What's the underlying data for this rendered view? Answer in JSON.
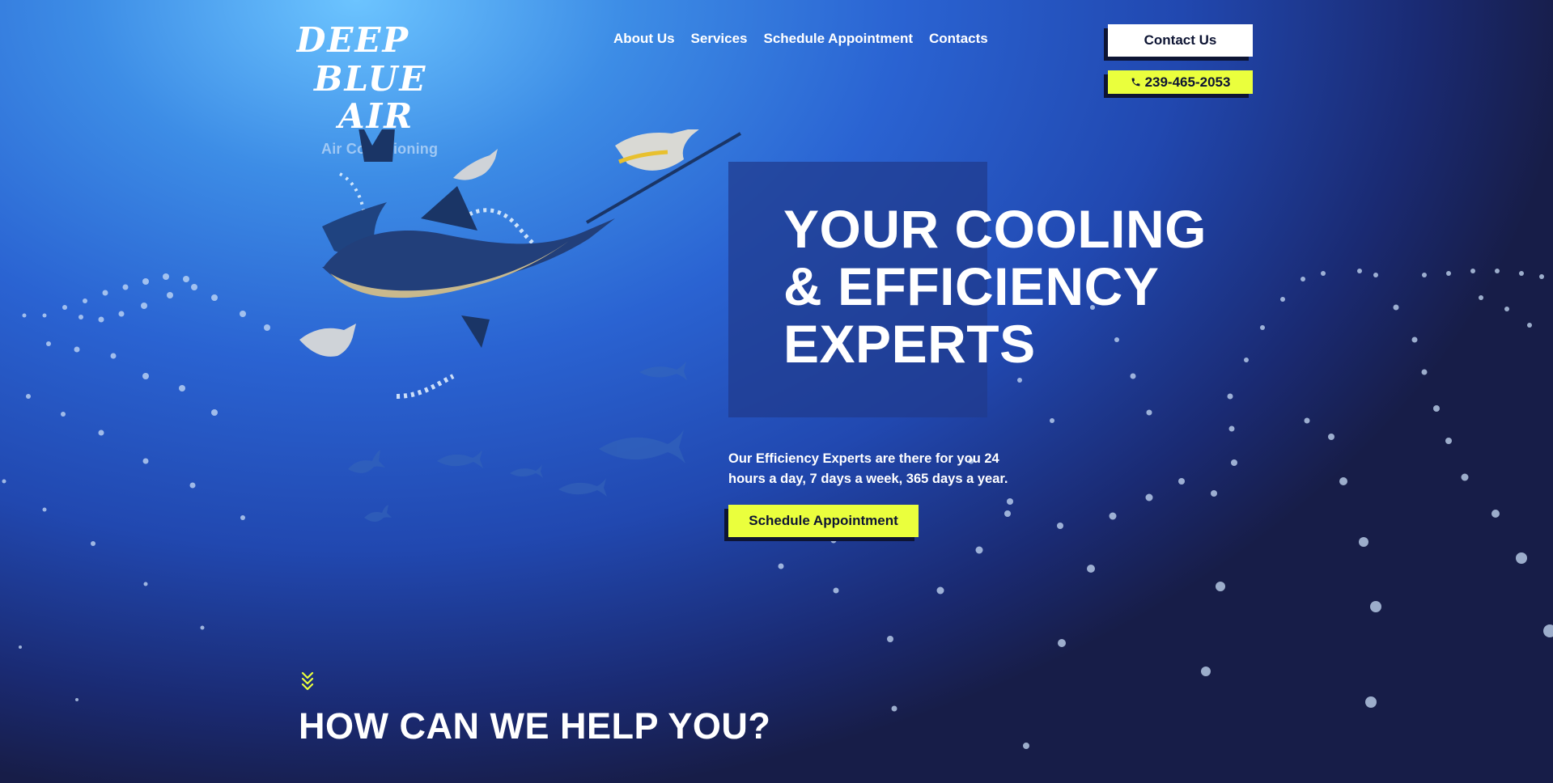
{
  "brand": {
    "logo_text": [
      "DEEP",
      "BLUE",
      "AIR"
    ],
    "subtitle": "Air Conditioning"
  },
  "nav": {
    "items": [
      {
        "label": "About Us"
      },
      {
        "label": "Services"
      },
      {
        "label": "Schedule Appointment"
      },
      {
        "label": "Contacts"
      }
    ]
  },
  "header_actions": {
    "contact_label": "Contact Us",
    "phone": "239-465-2053",
    "phone_icon": "phone-icon"
  },
  "hero": {
    "title_lines": [
      "YOUR COOLING",
      "& EFFICIENCY",
      "EXPERTS"
    ],
    "description": "Our Efficiency Experts are there for you 24 hours a day, 7 days a week, 365 days a year.",
    "cta_label": "Schedule Appointment",
    "illustration": "fish-illustration"
  },
  "section": {
    "heading": "HOW CAN WE HELP YOU?",
    "scroll_icon": "chevron-down-icon"
  },
  "colors": {
    "accent": "#eaff3d",
    "dark": "#0d1433",
    "bg_light": "#6cc4ff",
    "bg_dark": "#171d48"
  }
}
